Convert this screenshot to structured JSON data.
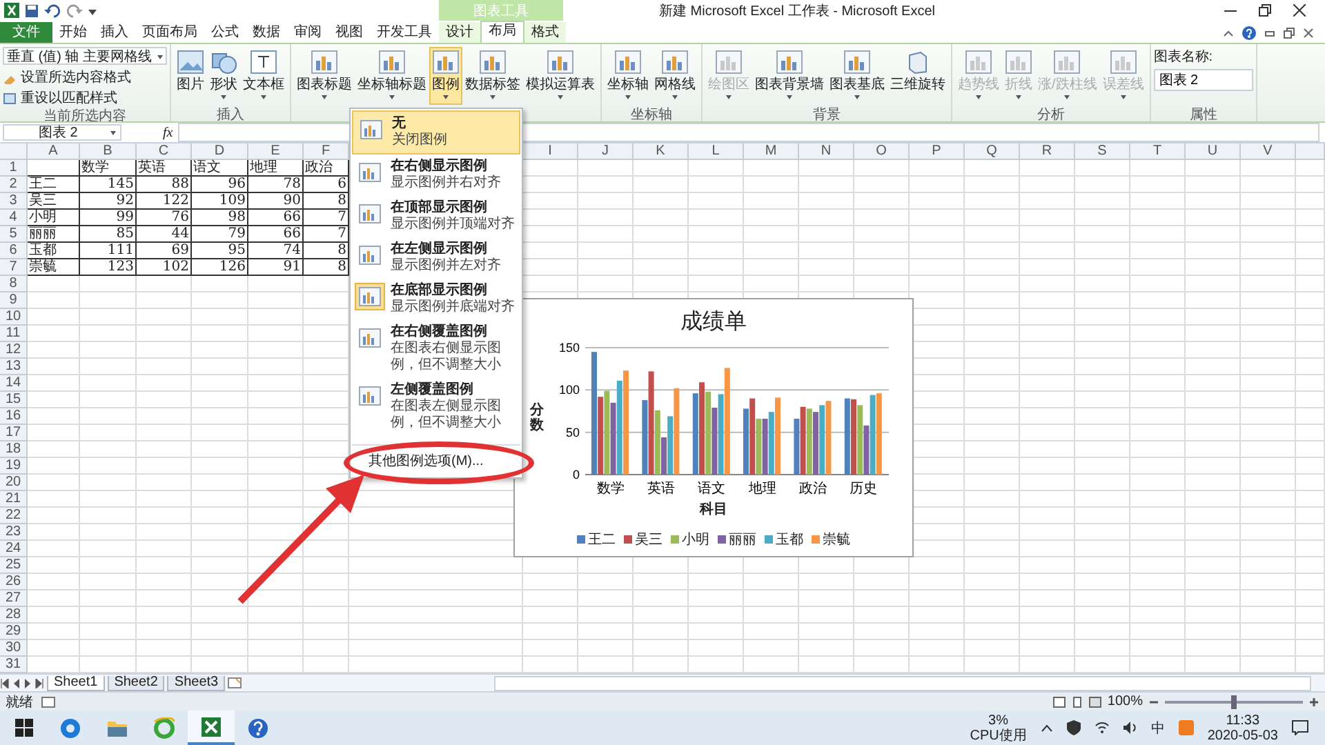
{
  "window": {
    "title": "新建 Microsoft Excel 工作表 - Microsoft Excel",
    "context_group": "图表工具"
  },
  "tabs": [
    {
      "label": "文件",
      "kind": "file",
      "selected": false
    },
    {
      "label": "开始",
      "kind": "normal",
      "selected": false
    },
    {
      "label": "插入",
      "kind": "normal",
      "selected": false
    },
    {
      "label": "页面布局",
      "kind": "normal",
      "selected": false
    },
    {
      "label": "公式",
      "kind": "normal",
      "selected": false
    },
    {
      "label": "数据",
      "kind": "normal",
      "selected": false
    },
    {
      "label": "审阅",
      "kind": "normal",
      "selected": false
    },
    {
      "label": "视图",
      "kind": "normal",
      "selected": false
    },
    {
      "label": "开发工具",
      "kind": "normal",
      "selected": false
    },
    {
      "label": "设计",
      "kind": "context",
      "selected": false
    },
    {
      "label": "布局",
      "kind": "context",
      "selected": true
    },
    {
      "label": "格式",
      "kind": "context",
      "selected": false
    }
  ],
  "ribbon": {
    "groups": [
      {
        "kind": "selection",
        "label": "当前所选内容",
        "dropdown": "垂直 (值) 轴 主要网格线",
        "commands": [
          "设置所选内容格式",
          "重设以匹配样式"
        ]
      },
      {
        "kind": "buttons",
        "label": "插入",
        "buttons": [
          {
            "label": "图片",
            "dropdown": false,
            "disabled": false,
            "selected": false
          },
          {
            "label": "形状",
            "dropdown": true,
            "disabled": false,
            "selected": false
          },
          {
            "label": "文本框",
            "dropdown": true,
            "disabled": false,
            "selected": false
          }
        ]
      },
      {
        "kind": "buttons",
        "buttons": [
          {
            "label": "图表标题",
            "dropdown": true,
            "disabled": false,
            "selected": false
          },
          {
            "label": "坐标轴标题",
            "dropdown": true,
            "disabled": false,
            "selected": false
          },
          {
            "label": "图例",
            "dropdown": true,
            "disabled": false,
            "selected": true
          },
          {
            "label": "数据标签",
            "dropdown": true,
            "disabled": false,
            "selected": false
          },
          {
            "label": "模拟运算表",
            "dropdown": true,
            "disabled": false,
            "selected": false
          }
        ]
      },
      {
        "kind": "buttons",
        "label": "坐标轴",
        "buttons": [
          {
            "label": "坐标轴",
            "dropdown": true,
            "disabled": false,
            "selected": false
          },
          {
            "label": "网格线",
            "dropdown": true,
            "disabled": false,
            "selected": false
          }
        ]
      },
      {
        "kind": "buttons",
        "label": "背景",
        "buttons": [
          {
            "label": "绘图区",
            "dropdown": true,
            "disabled": true,
            "selected": false
          },
          {
            "label": "图表背景墙",
            "dropdown": true,
            "disabled": false,
            "selected": false
          },
          {
            "label": "图表基底",
            "dropdown": true,
            "disabled": false,
            "selected": false
          },
          {
            "label": "三维旋转",
            "dropdown": false,
            "disabled": false,
            "selected": false
          }
        ]
      },
      {
        "kind": "buttons",
        "label": "分析",
        "buttons": [
          {
            "label": "趋势线",
            "dropdown": true,
            "disabled": true,
            "selected": false
          },
          {
            "label": "折线",
            "dropdown": true,
            "disabled": true,
            "selected": false
          },
          {
            "label": "涨/跌柱线",
            "dropdown": true,
            "disabled": true,
            "selected": false
          },
          {
            "label": "误差线",
            "dropdown": true,
            "disabled": true,
            "selected": false
          }
        ]
      },
      {
        "kind": "property",
        "label": "属性",
        "field_label": "图表名称:",
        "value": "图表 2"
      }
    ]
  },
  "formula_bar": {
    "name_box": "图表 2",
    "function_label": "fx"
  },
  "sheet": {
    "columns_left": [
      "A",
      "B",
      "C",
      "D",
      "E",
      "F"
    ],
    "columns_right": [
      "I",
      "J",
      "K",
      "L",
      "M",
      "N",
      "O",
      "P",
      "Q",
      "R",
      "S",
      "T",
      "U",
      "V"
    ],
    "row_numbers": [
      "1",
      "2",
      "3",
      "4",
      "5",
      "6",
      "7",
      "8",
      "9",
      "10",
      "11",
      "12",
      "13",
      "14",
      "15",
      "16",
      "17",
      "18",
      "19",
      "20",
      "21",
      "22",
      "23",
      "24",
      "25",
      "26",
      "27",
      "28",
      "29",
      "30",
      "31"
    ],
    "headers": [
      "数学",
      "英语",
      "语文",
      "地理",
      "政治"
    ],
    "rows": [
      {
        "name": "王二",
        "values": [
          "145",
          "88",
          "96",
          "78",
          "6"
        ]
      },
      {
        "name": "吴三",
        "values": [
          "92",
          "122",
          "109",
          "90",
          "8"
        ]
      },
      {
        "name": "小明",
        "values": [
          "99",
          "76",
          "98",
          "66",
          "7"
        ]
      },
      {
        "name": "丽丽",
        "values": [
          "85",
          "44",
          "79",
          "66",
          "7"
        ]
      },
      {
        "name": "玉都",
        "values": [
          "111",
          "69",
          "95",
          "74",
          "8"
        ]
      },
      {
        "name": "崇毓",
        "values": [
          "123",
          "102",
          "126",
          "91",
          "8"
        ]
      }
    ]
  },
  "legend_menu": {
    "items": [
      {
        "title": "无",
        "description": "关闭图例",
        "highlighted": true,
        "checked": false
      },
      {
        "title": "在右侧显示图例",
        "description": "显示图例并右对齐",
        "highlighted": false,
        "checked": false
      },
      {
        "title": "在顶部显示图例",
        "description": "显示图例并顶端对齐",
        "highlighted": false,
        "checked": false
      },
      {
        "title": "在左侧显示图例",
        "description": "显示图例并左对齐",
        "highlighted": false,
        "checked": false
      },
      {
        "title": "在底部显示图例",
        "description": "显示图例并底端对齐",
        "highlighted": false,
        "checked": true
      },
      {
        "title": "在右侧覆盖图例",
        "description": "在图表右侧显示图例，但不调整大小",
        "highlighted": false,
        "checked": false
      },
      {
        "title": "左侧覆盖图例",
        "description": "在图表左侧显示图例，但不调整大小",
        "highlighted": false,
        "checked": false
      }
    ],
    "more": "其他图例选项(M)..."
  },
  "chart": {
    "chart_data": {
      "type": "bar",
      "title": "成绩单",
      "xlabel": "科目",
      "ylabel": "分数",
      "categories": [
        "数学",
        "英语",
        "语文",
        "地理",
        "政治",
        "历史"
      ],
      "series": [
        {
          "name": "王二",
          "color": "#4f81bd",
          "values": [
            145,
            88,
            96,
            78,
            66,
            90
          ]
        },
        {
          "name": "吴三",
          "color": "#c0504d",
          "values": [
            92,
            122,
            109,
            90,
            80,
            89
          ]
        },
        {
          "name": "小明",
          "color": "#9bbb59",
          "values": [
            99,
            76,
            98,
            66,
            78,
            82
          ]
        },
        {
          "name": "丽丽",
          "color": "#8064a2",
          "values": [
            85,
            44,
            79,
            66,
            74,
            58
          ]
        },
        {
          "name": "玉都",
          "color": "#4bacc6",
          "values": [
            111,
            69,
            95,
            74,
            82,
            94
          ]
        },
        {
          "name": "崇毓",
          "color": "#f79646",
          "values": [
            123,
            102,
            126,
            91,
            87,
            96
          ]
        }
      ],
      "ylim": [
        0,
        150
      ],
      "yticks": [
        0,
        50,
        100,
        150
      ],
      "legend": "bottom"
    }
  },
  "sheet_tabs": [
    {
      "label": "Sheet1",
      "selected": true
    },
    {
      "label": "Sheet2",
      "selected": false
    },
    {
      "label": "Sheet3",
      "selected": false
    }
  ],
  "status_bar": {
    "status": "就绪",
    "zoom": "100%",
    "zoom_slider": {
      "level": 0.5
    }
  },
  "taskbar": {
    "apps": [
      {
        "selected": false
      },
      {
        "selected": false
      },
      {
        "selected": false
      },
      {
        "selected": true
      },
      {
        "selected": false
      }
    ],
    "cpu_value": "3%",
    "cpu_label": "CPU使用",
    "ime": "中",
    "time": "11:33",
    "date": "2020-05-03"
  }
}
